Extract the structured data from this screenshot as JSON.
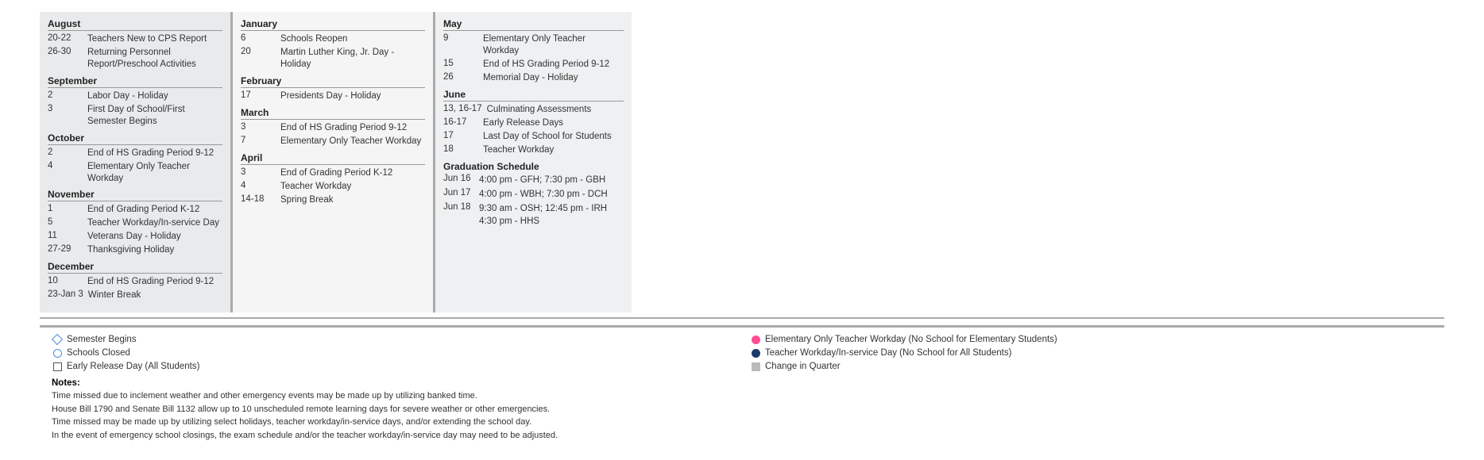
{
  "columns": {
    "left": {
      "months": [
        {
          "name": "August",
          "events": [
            {
              "date": "20-22",
              "desc": "Teachers New to CPS Report"
            },
            {
              "date": "26-30",
              "desc": "Returning Personnel Report/Preschool Activities"
            }
          ]
        },
        {
          "name": "September",
          "events": [
            {
              "date": "2",
              "desc": "Labor Day - Holiday"
            },
            {
              "date": "3",
              "desc": "First Day of School/First Semester Begins"
            }
          ]
        },
        {
          "name": "October",
          "events": [
            {
              "date": "2",
              "desc": "End of HS Grading Period 9-12"
            },
            {
              "date": "4",
              "desc": "Elementary Only Teacher Workday"
            }
          ]
        },
        {
          "name": "November",
          "events": [
            {
              "date": "1",
              "desc": "End of Grading Period K-12"
            },
            {
              "date": "5",
              "desc": "Teacher Workday/In-service Day"
            },
            {
              "date": "11",
              "desc": "Veterans Day - Holiday"
            },
            {
              "date": "27-29",
              "desc": "Thanksgiving Holiday"
            }
          ]
        },
        {
          "name": "December",
          "events": [
            {
              "date": "10",
              "desc": "End of HS Grading Period 9-12"
            },
            {
              "date": "23-Jan 3",
              "desc": "Winter Break"
            }
          ]
        }
      ]
    },
    "mid": {
      "months": [
        {
          "name": "January",
          "events": [
            {
              "date": "6",
              "desc": "Schools Reopen"
            },
            {
              "date": "20",
              "desc": "Martin Luther King, Jr. Day - Holiday"
            }
          ]
        },
        {
          "name": "February",
          "events": [
            {
              "date": "17",
              "desc": "Presidents Day - Holiday"
            }
          ]
        },
        {
          "name": "March",
          "events": [
            {
              "date": "3",
              "desc": "End of HS Grading Period 9-12"
            },
            {
              "date": "7",
              "desc": "Elementary Only Teacher Workday"
            }
          ]
        },
        {
          "name": "April",
          "events": [
            {
              "date": "3",
              "desc": "End of Grading Period K-12"
            },
            {
              "date": "4",
              "desc": "Teacher Workday"
            },
            {
              "date": "14-18",
              "desc": "Spring Break"
            }
          ]
        }
      ]
    },
    "right": {
      "months": [
        {
          "name": "May",
          "events": [
            {
              "date": "9",
              "desc": "Elementary Only Teacher Workday"
            },
            {
              "date": "15",
              "desc": "End of HS Grading Period 9-12"
            },
            {
              "date": "26",
              "desc": "Memorial Day - Holiday"
            }
          ]
        },
        {
          "name": "June",
          "events": [
            {
              "date": "13, 16-17",
              "desc": "Culminating Assessments"
            },
            {
              "date": "16-17",
              "desc": "Early Release Days"
            },
            {
              "date": "17",
              "desc": "Last Day of School for Students"
            },
            {
              "date": "18",
              "desc": "Teacher Workday"
            }
          ]
        }
      ],
      "graduation": {
        "title": "Graduation Schedule",
        "events": [
          {
            "date": "Jun 16",
            "desc": "4:00 pm - GFH; 7:30 pm - GBH"
          },
          {
            "date": "Jun 17",
            "desc": "4:00 pm - WBH; 7:30 pm - DCH"
          },
          {
            "date": "Jun 18",
            "desc": "9:30 am - OSH; 12:45 pm - IRH\n4:30 pm - HHS"
          }
        ]
      }
    }
  },
  "legend": {
    "items": [
      {
        "icon": "diamond",
        "label": "Semester Begins"
      },
      {
        "icon": "circle-pink",
        "label": "Elementary Only Teacher Workday (No School for Elementary Students)"
      },
      {
        "icon": "circle-outline",
        "label": "Schools Closed"
      },
      {
        "icon": "circle-darkblue",
        "label": "Teacher Workday/In-service Day (No School for All Students)"
      },
      {
        "icon": "square-outline",
        "label": "Early Release Day (All Students)"
      },
      {
        "icon": "square-gray",
        "label": "Change in Quarter"
      }
    ]
  },
  "notes": {
    "title": "Notes:",
    "lines": [
      "Time missed due to inclement weather and other emergency events may be made up by utilizing banked time.",
      "House Bill 1790 and Senate Bill 1132 allow up to 10 unscheduled remote learning days for severe weather or other emergencies.",
      "Time missed may be made up by utilizing select holidays, teacher workday/in-service days, and/or extending the school day.",
      "In the event of emergency school closings, the exam schedule and/or the teacher workday/in-service day may need to be adjusted."
    ]
  }
}
